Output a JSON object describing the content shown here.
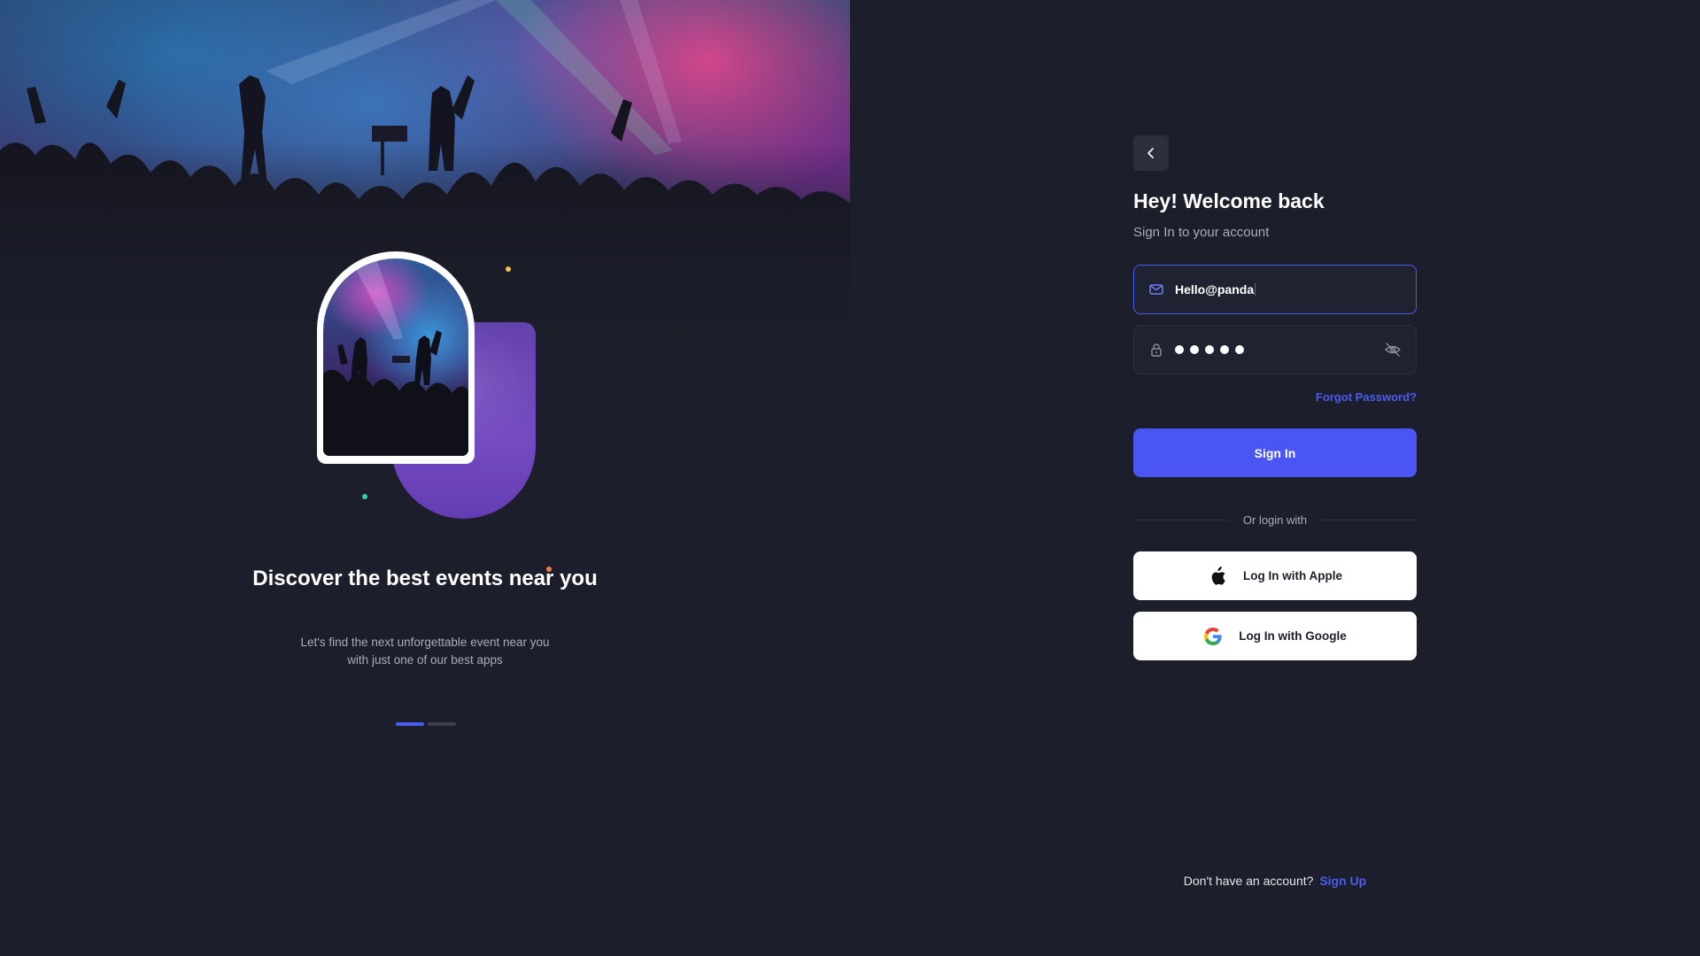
{
  "hero": {
    "title": "Discover the best events near you",
    "subtitle_line1": "Let's find the next unforgettable event near you",
    "subtitle_line2": "with just one of our best apps",
    "pager": {
      "count": 2,
      "active_index": 0
    }
  },
  "form": {
    "back_icon": "chevron-left-icon",
    "title": "Hey! Welcome back",
    "subtitle": "Sign In to your account",
    "email": {
      "icon": "mail-icon",
      "value": "Hello@panda"
    },
    "password": {
      "icon": "lock-icon",
      "masked_length": 5,
      "toggle_icon": "eye-off-icon"
    },
    "forgot_label": "Forgot Password?",
    "signin_label": "Sign In",
    "divider_label": "Or login with",
    "apple": {
      "icon": "apple-icon",
      "label": "Log In with Apple"
    },
    "google": {
      "icon": "google-icon",
      "label": "Log In with Google"
    },
    "signup_prompt": "Don't have an account?",
    "signup_label": "Sign Up"
  },
  "colors": {
    "background": "#1c1f2b",
    "accent": "#4a55f2",
    "link": "#4a5cf0",
    "muted_text": "#a9adbb"
  }
}
